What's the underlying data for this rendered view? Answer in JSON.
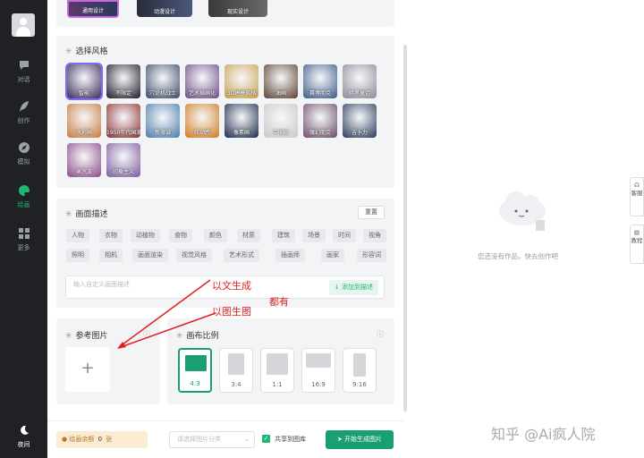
{
  "sidebar": {
    "items": [
      {
        "label": "对话",
        "icon": "chat-bubble-icon"
      },
      {
        "label": "创作",
        "icon": "feather-icon"
      },
      {
        "label": "模拟",
        "icon": "compass-icon"
      },
      {
        "label": "绘画",
        "icon": "palette-icon",
        "active": true
      },
      {
        "label": "更多",
        "icon": "grid-icon"
      }
    ],
    "night_label": "夜间"
  },
  "top_tiles": [
    "通用设计",
    "动漫设计",
    "现实设计"
  ],
  "style_section": {
    "title": "选择风格",
    "styles": [
      {
        "label": "智能",
        "color": "#3a2a5a"
      },
      {
        "label": "不限定",
        "color": "#1b1b2a"
      },
      {
        "label": "穴论机战士",
        "color": "#3a4a6a"
      },
      {
        "label": "艺术插画化",
        "color": "#6a4a8a"
      },
      {
        "label": "3D建模风格",
        "color": "#c8a050"
      },
      {
        "label": "油画",
        "color": "#5a4030"
      },
      {
        "label": "赛博朋克",
        "color": "#3a5a8a"
      },
      {
        "label": "暗黑童话",
        "color": "#8a8a9a"
      },
      {
        "label": "水彩画",
        "color": "#c87a40"
      },
      {
        "label": "1950年代国潮",
        "color": "#8a3030"
      },
      {
        "label": "新海诚",
        "color": "#4a7aaa"
      },
      {
        "label": "炫动感",
        "color": "#d07a20"
      },
      {
        "label": "像素画",
        "color": "#1a2a4a"
      },
      {
        "label": "中国画",
        "color": "#c8c8c8"
      },
      {
        "label": "魔幻朋克",
        "color": "#6a4a6a"
      },
      {
        "label": "吉卜力",
        "color": "#2a3a5a"
      },
      {
        "label": "蒸汽波",
        "color": "#8a4a8a"
      },
      {
        "label": "印象主义",
        "color": "#7a5aa0"
      }
    ]
  },
  "description": {
    "title": "画面描述",
    "reset_label": "重置",
    "tags_row1": [
      "人物",
      "衣物",
      "动植物",
      "食物",
      "颜色",
      "材质",
      "建筑",
      "场景",
      "时间",
      "视角"
    ],
    "tags_row2": [
      "照明",
      "相机",
      "画面渲染",
      "视觉风格",
      "艺术形式",
      "插画师",
      "画家",
      "形容词"
    ],
    "placeholder": "输入自定义画面描述",
    "add_label": "添加到描述"
  },
  "reference": {
    "title": "参考图片",
    "upload_symbol": "+"
  },
  "ratio": {
    "title": "画布比例",
    "options": [
      "4:3",
      "3:4",
      "1:1",
      "16:9",
      "9:16"
    ],
    "selected": "4:3"
  },
  "bottom": {
    "balance_label": "绘画余额",
    "balance_value": "0",
    "balance_unit": "张",
    "category_placeholder": "请选择图片分类",
    "share_label": "共享到图库",
    "share_checked": true,
    "generate_label": "开始生成图片"
  },
  "annotations": {
    "text_to_image": "以文生成",
    "both": "都有",
    "image_to_image": "以图生图"
  },
  "empty_state": {
    "text": "您还没有作品，快去创作吧"
  },
  "side_tabs": [
    "客服",
    "教程"
  ],
  "watermark": "知乎 @Ai疯人院"
}
